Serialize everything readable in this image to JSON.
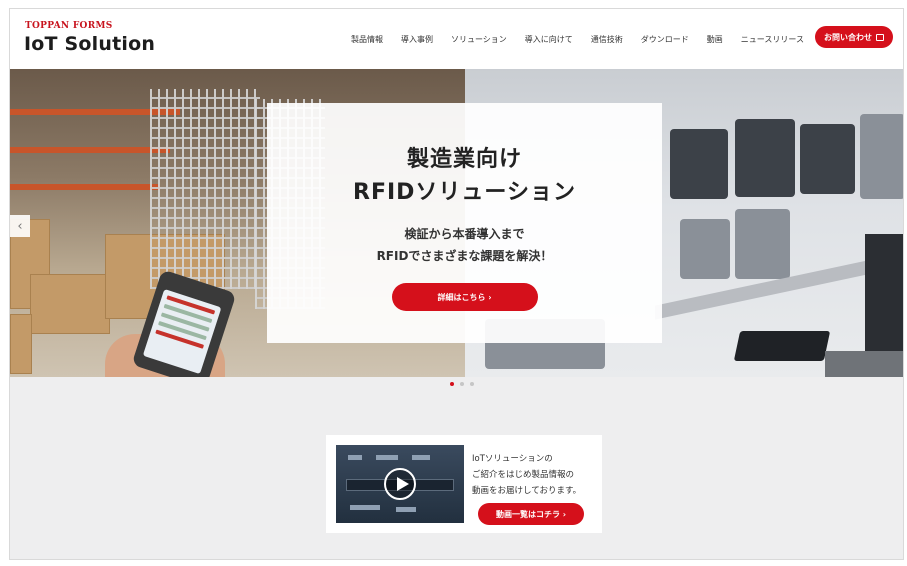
{
  "brand": {
    "company": "TOPPAN FORMS",
    "product": "IoT Solution"
  },
  "nav": {
    "items": [
      "製品情報",
      "導入事例",
      "ソリューション",
      "導入に向けて",
      "通信技術",
      "ダウンロード",
      "動画",
      "ニュースリリース"
    ],
    "contact_label": "お問い合わせ"
  },
  "hero": {
    "title_line1": "製造業向け",
    "title_line2": "RFIDソリューション",
    "sub_line1": "検証から本番導入まで",
    "sub_line2": "RFIDでさまざまな課題を解決！",
    "button_label": "詳細はこちら ›",
    "prev_arrow": "‹",
    "slide_count": 3,
    "active_slide": 1
  },
  "video": {
    "text_line1": "IoTソリューションの",
    "text_line2": "ご紹介をはじめ製品情報の",
    "text_line3": "動画をお届けしております。",
    "button_label": "動画一覧はコチラ ›"
  },
  "colors": {
    "accent": "#d5101b",
    "background": "#eeeeef"
  }
}
